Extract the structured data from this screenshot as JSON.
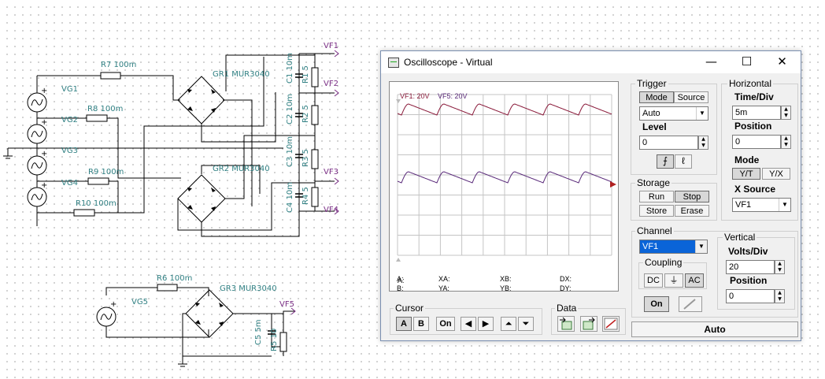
{
  "schematic": {
    "sources": [
      {
        "name": "VG1"
      },
      {
        "name": "VG2"
      },
      {
        "name": "VG3"
      },
      {
        "name": "VG4"
      },
      {
        "name": "VG5"
      }
    ],
    "resistors": [
      {
        "name": "R7 100m"
      },
      {
        "name": "R8 100m"
      },
      {
        "name": "R9 100m"
      },
      {
        "name": "R10 100m"
      },
      {
        "name": "R6 100m"
      }
    ],
    "bridges": [
      {
        "name": "GR1 MUR3040"
      },
      {
        "name": "GR2 MUR3040"
      },
      {
        "name": "GR3 MUR3040"
      }
    ],
    "capacitors": [
      {
        "name": "C1 10m"
      },
      {
        "name": "C2 10m"
      },
      {
        "name": "C3 10m"
      },
      {
        "name": "C4 10m"
      },
      {
        "name": "C5 5m"
      }
    ],
    "loads": [
      {
        "name": "R1 5"
      },
      {
        "name": "R2 5"
      },
      {
        "name": "R3 5"
      },
      {
        "name": "R4 5"
      },
      {
        "name": "R5 10"
      }
    ],
    "probes": [
      {
        "name": "VF1"
      },
      {
        "name": "VF2"
      },
      {
        "name": "VF3"
      },
      {
        "name": "VF4"
      },
      {
        "name": "VF5"
      }
    ],
    "plus_sign": "+",
    "colors": {
      "wire": "#000000",
      "label": "#2f7f82",
      "probe": "#7a2f85",
      "component": "#1a1a1a"
    }
  },
  "window": {
    "title": "Oscilloscope - Virtual",
    "controls": {
      "minimize": "—",
      "maximize": "☐",
      "close": "✕"
    }
  },
  "scope": {
    "channel_labels": [
      "VF1: 20V",
      "VF5: 20V"
    ],
    "readouts": {
      "a": "A:",
      "b": "B:",
      "xa": "XA:",
      "ya": "YA:",
      "xb": "XB:",
      "yb": "YB:",
      "dx": "DX:",
      "dy": "DY:"
    },
    "trace_color": "#8a1a3a",
    "trace2_color": "#5a2a7a",
    "grid_color": "#c0c0c0"
  },
  "trigger": {
    "title": "Trigger",
    "mode": "Mode",
    "source": "Source",
    "mode_value": "Auto",
    "level_label": "Level",
    "level_value": "0"
  },
  "horizontal": {
    "title": "Horizontal",
    "time_div_label": "Time/Div",
    "time_div_value": "5m",
    "position_label": "Position",
    "position_value": "0",
    "mode_label": "Mode",
    "yt": "Y/T",
    "yx": "Y/X",
    "xsource_label": "X Source",
    "xsource_value": "VF1"
  },
  "storage": {
    "title": "Storage",
    "run": "Run",
    "stop": "Stop",
    "store": "Store",
    "erase": "Erase"
  },
  "channel": {
    "title": "Channel",
    "value": "VF1"
  },
  "coupling": {
    "title": "Coupling",
    "dc": "DC",
    "gnd": "⏚",
    "ac": "AC",
    "on": "On"
  },
  "vertical": {
    "title": "Vertical",
    "volts_div_label": "Volts/Div",
    "volts_div_value": "20",
    "position_label": "Position",
    "position_value": "0"
  },
  "cursor": {
    "title": "Cursor",
    "a": "A",
    "b": "B",
    "on": "On"
  },
  "data": {
    "title": "Data"
  },
  "status": {
    "auto": "Auto"
  }
}
